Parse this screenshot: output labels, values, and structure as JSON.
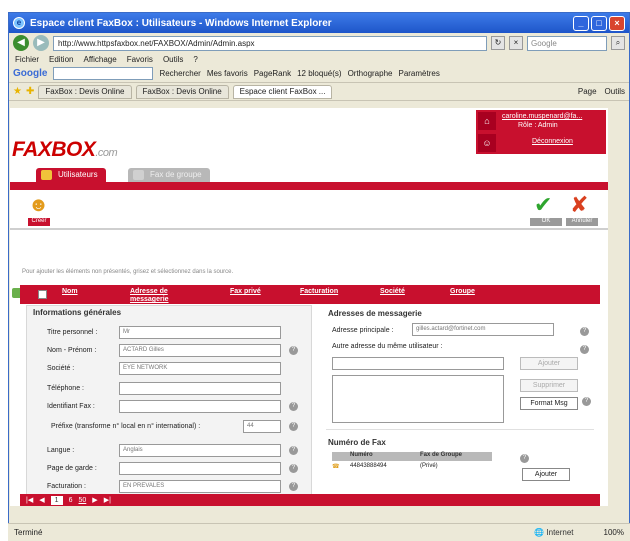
{
  "window": {
    "title": "Espace client FaxBox : Utilisateurs - Windows Internet Explorer",
    "url": "http://www.httpsfaxbox.net/FAXBOX/Admin/Admin.aspx",
    "search_placeholder": "Google"
  },
  "menu": [
    "Fichier",
    "Edition",
    "Affichage",
    "Favoris",
    "Outils",
    "?"
  ],
  "google_bar": {
    "logo": "Google",
    "items": [
      "Rechercher",
      "Mes favoris",
      "PageRank",
      "12 bloqué(s)",
      "Orthographe",
      "Paramètres"
    ]
  },
  "browser_tabs": [
    "FaxBox : Devis Online",
    "FaxBox : Devis Online",
    "Espace client FaxBox ..."
  ],
  "browser_tools": [
    "Page",
    "Outils"
  ],
  "header": {
    "logo_main": "FAXBOX",
    "logo_suffix": ".com",
    "user_link": "caroline.muspenard@fa...",
    "user_role": "Rôle : Admin",
    "logout": "Déconnexion"
  },
  "app_tabs": {
    "active": "Utilisateurs",
    "inactive": "Fax de groupe"
  },
  "actions": {
    "add_label": "Créer",
    "ok_label": "OK",
    "cancel_label": "Annuler"
  },
  "hint": "Pour ajouter les éléments non présentés, grisez et sélectionnez dans la source.",
  "table": {
    "columns": [
      "Nom",
      "Adresse de messagerie",
      "Fax privé",
      "Facturation",
      "Société",
      "Groupe"
    ]
  },
  "general": {
    "title": "Informations générales",
    "fields": [
      {
        "label": "Titre personnel :",
        "value": "Mr"
      },
      {
        "label": "Nom - Prénom :",
        "value": "ACTARD Gilles"
      },
      {
        "label": "Société :",
        "value": "EYE NETWORK"
      },
      {
        "label": "Téléphone :",
        "value": ""
      },
      {
        "label": "Identifiant Fax :",
        "value": ""
      }
    ],
    "prefix_label": "Préfixe (transforme n° local en n° international) :",
    "prefix_value": "44",
    "language_label": "Langue :",
    "language_value": "Anglais",
    "cover_label": "Page de garde :",
    "cover_value": "",
    "billing_label": "Facturation :",
    "billing_value": "EN PREVALES"
  },
  "messaging": {
    "title": "Adresses de messagerie",
    "main_label": "Adresse principale :",
    "main_value": "gilles.actard@fortinet.com",
    "other_label": "Autre adresse du même utilisateur :",
    "add_button": "Ajouter",
    "remove_button": "Supprimer",
    "format_button": "Format Msg"
  },
  "fax_numbers": {
    "title": "Numéro de Fax",
    "headers": [
      "Numéro",
      "Fax de Groupe"
    ],
    "rows": [
      {
        "number": "44843888494",
        "type": "(Privé)"
      }
    ],
    "add_button": "Ajouter"
  },
  "pager": {
    "page": "1",
    "of": "6",
    "pagesize": "50"
  },
  "status": {
    "left": "Terminé",
    "zone": "Internet",
    "zoom": "100%"
  }
}
